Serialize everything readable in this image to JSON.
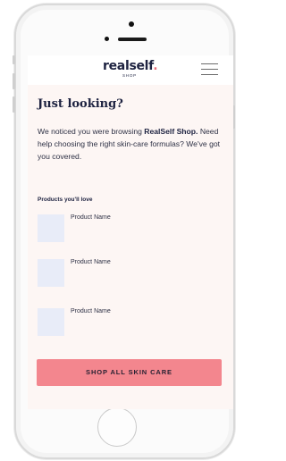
{
  "header": {
    "logo_text": "realself",
    "logo_dot": ".",
    "logo_sub": "SHOP",
    "menu_icon": "hamburger-menu-icon"
  },
  "main": {
    "title": "Just looking?",
    "intro_prefix": "We noticed you were browsing ",
    "intro_bold": "RealSelf Shop.",
    "intro_suffix": " Need help choosing the right skin-care formulas? We've got you covered."
  },
  "products": {
    "label": "Products you'll love",
    "items": [
      {
        "name": "Product Name"
      },
      {
        "name": "Product Name"
      },
      {
        "name": "Product Name"
      }
    ]
  },
  "cta": {
    "label": "SHOP ALL SKIN CARE"
  },
  "colors": {
    "brand_navy": "#1d2240",
    "accent_pink": "#f3868e",
    "screen_bg": "#fdf6f4",
    "thumb_placeholder": "#e8ecf8"
  }
}
